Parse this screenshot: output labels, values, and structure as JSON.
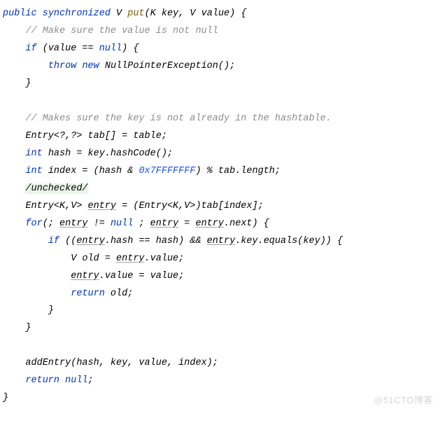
{
  "code": {
    "l1_public": "public",
    "l1_sync": "synchronized",
    "l1_v": "V",
    "l1_put": "put",
    "l1_k": "K",
    "l1_key": "key",
    "l1_v2": "V",
    "l1_value": "value",
    "l2_comment": "// Make sure the value is not null",
    "l3_if": "if",
    "l3_cond": "(value == ",
    "l3_null": "null",
    "l3_end": ") {",
    "l4_throw": "throw",
    "l4_new": "new",
    "l4_npe": "NullPointerException",
    "l5_brace": "}",
    "l7_comment": "// Makes sure the key is not already in the hashtable.",
    "l8_entry": "Entry<?,?> tab[] = table;",
    "l9_int": "int",
    "l9_rest": " hash = key.hashCode();",
    "l10_int": "int",
    "l10_a": " index = (hash & ",
    "l10_hex": "0x7FFFFFFF",
    "l10_b": ") % tab.",
    "l10_len": "length",
    "l10_c": ";",
    "l11_unchecked": "/unchecked/",
    "l12_a": "Entry<K,V> ",
    "l12_entry": "entry",
    "l12_b": " = (Entry<K,V>)tab[index];",
    "l13_for": "for",
    "l13_a": "(; ",
    "l13_e1": "entry",
    "l13_b": " != ",
    "l13_null": "null",
    "l13_c": " ; ",
    "l13_e2": "entry",
    "l13_d": " = ",
    "l13_e3": "entry",
    "l13_e": ".next) {",
    "l14_if": "if",
    "l14_a": " ((",
    "l14_e1": "entry",
    "l14_b": ".hash == hash) && ",
    "l14_e2": "entry",
    "l14_c": ".key.equals(key)) {",
    "l15_a": "V old = ",
    "l15_e": "entry",
    "l15_b": ".value;",
    "l16_e": "entry",
    "l16_b": ".value = value;",
    "l17_ret": "return",
    "l17_b": " old;",
    "l18_brace": "}",
    "l19_brace": "}",
    "l21_add": "addEntry(hash, key, value, index);",
    "l22_ret": "return",
    "l22_null": "null",
    "l23_brace": "}"
  },
  "watermark": "@51CTO博客"
}
